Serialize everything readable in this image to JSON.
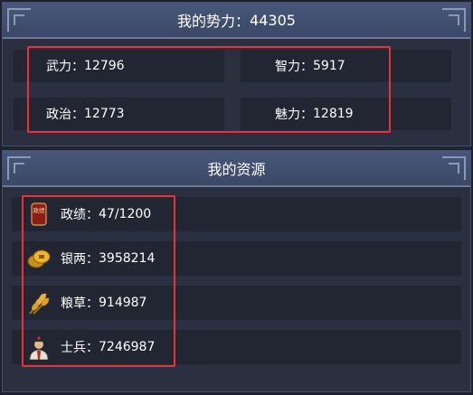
{
  "power": {
    "label": "我的势力：",
    "value": "44305"
  },
  "attributes": [
    {
      "label": "武力：",
      "value": "12796"
    },
    {
      "label": "智力：",
      "value": "5917"
    },
    {
      "label": "政治：",
      "value": "12773"
    },
    {
      "label": "魅力：",
      "value": "12819"
    }
  ],
  "resources": {
    "title": "我的资源",
    "items": [
      {
        "icon": "merit-seal-icon",
        "icon_text": "政绩",
        "label": "政绩：",
        "value": "47/1200"
      },
      {
        "icon": "silver-coins-icon",
        "label": "银两：",
        "value": "3958214"
      },
      {
        "icon": "grain-icon",
        "label": "粮草：",
        "value": "914987"
      },
      {
        "icon": "soldier-icon",
        "label": "士兵：",
        "value": "7246987"
      }
    ]
  },
  "colors": {
    "highlight_border": "#e8333c",
    "header_bg": "#48577a",
    "panel_bg": "#2a3040",
    "cell_bg": "#222633"
  }
}
